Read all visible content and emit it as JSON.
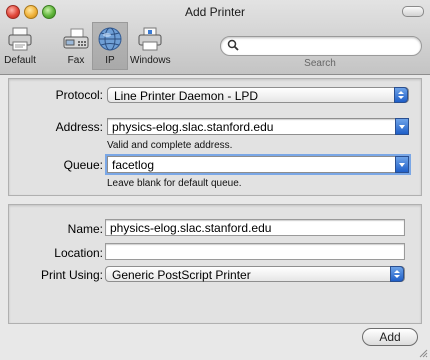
{
  "window": {
    "title": "Add Printer"
  },
  "toolbar": {
    "items": [
      {
        "label": "Default",
        "icon": "printer-icon"
      },
      {
        "label": "Fax",
        "icon": "fax-icon"
      },
      {
        "label": "IP",
        "icon": "globe-icon"
      },
      {
        "label": "Windows",
        "icon": "windows-printer-icon"
      }
    ],
    "selected": "IP",
    "search": {
      "placeholder": "",
      "label": "Search"
    }
  },
  "connection": {
    "protocol_label": "Protocol:",
    "protocol_value": "Line Printer Daemon - LPD",
    "address_label": "Address:",
    "address_value": "physics-elog.slac.stanford.edu",
    "address_hint": "Valid and complete address.",
    "queue_label": "Queue:",
    "queue_value": "facetlog",
    "queue_hint": "Leave blank for default queue."
  },
  "printer": {
    "name_label": "Name:",
    "name_value": "physics-elog.slac.stanford.edu",
    "location_label": "Location:",
    "location_value": "",
    "print_using_label": "Print Using:",
    "print_using_value": "Generic PostScript Printer"
  },
  "footer": {
    "add_label": "Add"
  },
  "colors": {
    "accent": "#2f6fd6",
    "panel": "#e2e2e2",
    "window": "#e8e8e8"
  }
}
